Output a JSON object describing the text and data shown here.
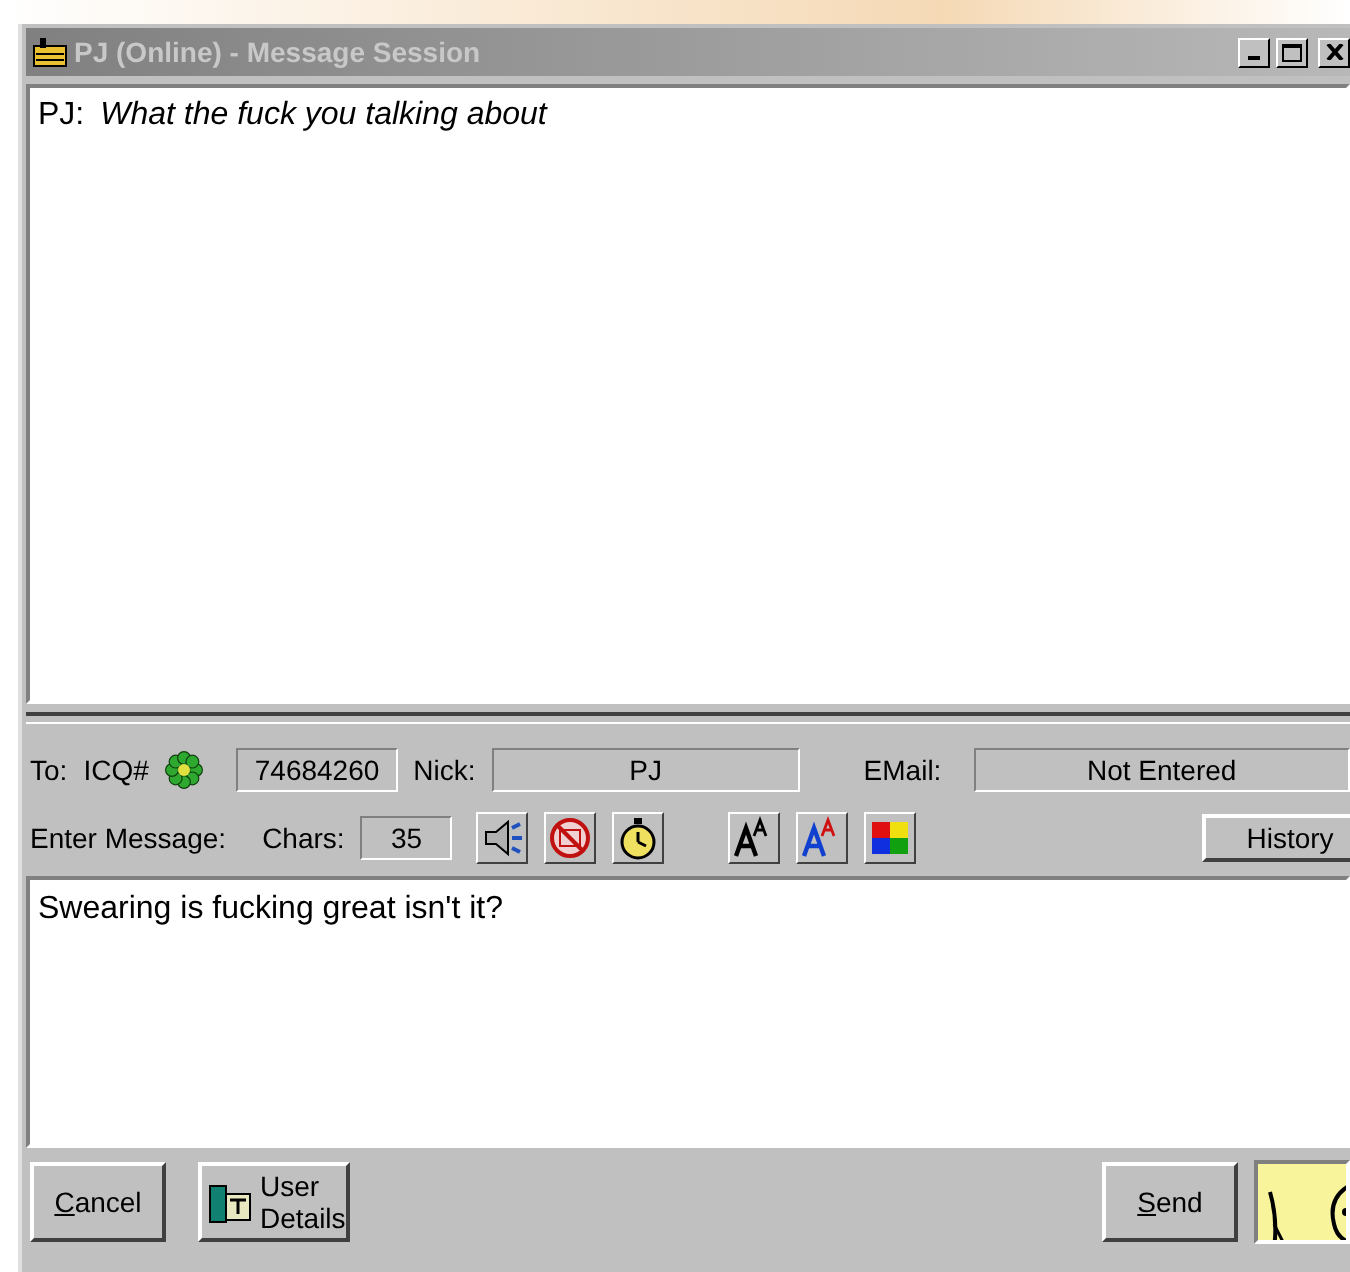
{
  "window": {
    "title": "PJ (Online) - Message Session",
    "active": false
  },
  "conversation": [
    {
      "sender": "PJ:",
      "text": "What the fuck you talking about"
    }
  ],
  "contact": {
    "to_label": "To:",
    "icq_label": "ICQ#",
    "online": true,
    "uin": "74684260",
    "nick_label": "Nick:",
    "nick": "PJ",
    "email_label": "EMail:",
    "email": "Not Entered"
  },
  "compose": {
    "label": "Enter Message:",
    "chars_label": "Chars:",
    "chars": "35",
    "history_button": "History",
    "message": "Swearing is fucking great isn't it?"
  },
  "toolbar": [
    {
      "kind": "sound"
    },
    {
      "kind": "chat"
    },
    {
      "kind": "timer"
    },
    {
      "kind": "font"
    },
    {
      "kind": "font-color"
    },
    {
      "kind": "background-color"
    }
  ],
  "buttons": [
    {
      "kind": "cancel",
      "label": "Cancel",
      "mnemonic": true
    },
    {
      "kind": "details",
      "label": "User Details",
      "mnemonic": false
    },
    {
      "kind": "send",
      "label": "Send",
      "mnemonic": true
    }
  ]
}
